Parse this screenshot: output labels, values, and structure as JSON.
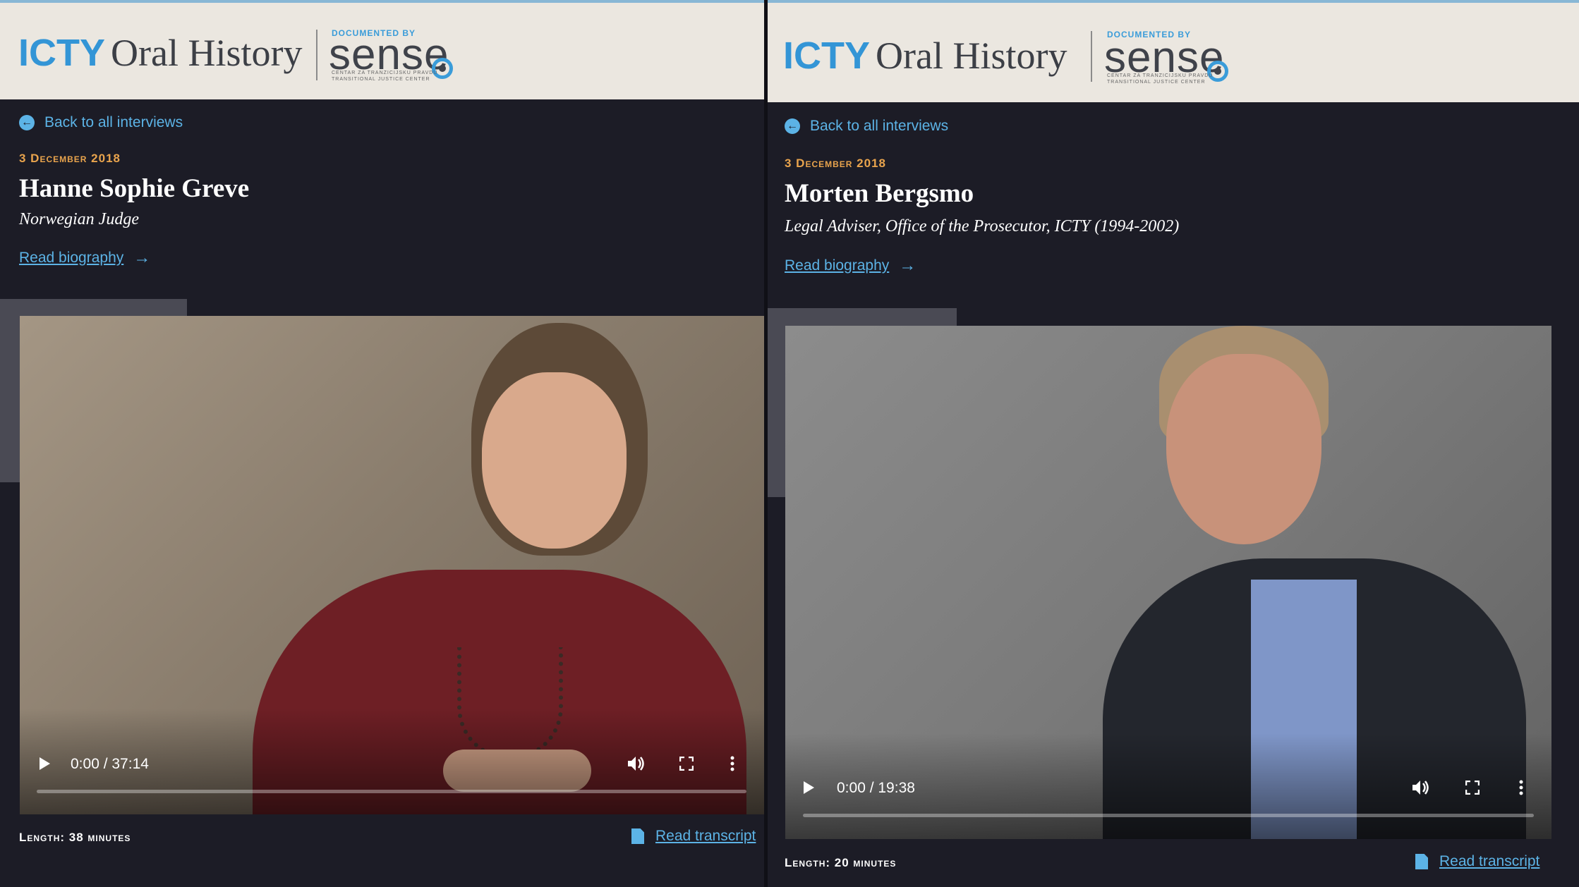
{
  "brand": {
    "icty": "ICTY",
    "oral_history": "Oral History",
    "documented_by": "DOCUMENTED BY",
    "sense": "sense",
    "sense_tagline_1": "CENTAR ZA TRANZICIJSKU PRAVDU",
    "sense_tagline_2": "TRANSITIONAL JUSTICE CENTER"
  },
  "icons": {
    "back": "arrow-left-circle-icon",
    "bio_arrow": "arrow-right-icon",
    "play": "play-icon",
    "volume": "volume-icon",
    "fullscreen": "fullscreen-icon",
    "more": "more-vertical-icon",
    "pdf": "pdf-file-icon"
  },
  "colors": {
    "accent_blue": "#5cb3e6",
    "date_orange": "#e9a44d",
    "page_background": "#1c1c26",
    "header_background": "#ebe7e0"
  },
  "panels": [
    {
      "back_label": "Back to all interviews",
      "date": "3 December 2018",
      "name": "Hanne Sophie Greve",
      "role": "Norwegian Judge",
      "read_bio": "Read biography",
      "video_time": "0:00 / 37:14",
      "video_progress": 0,
      "length": "Length: 38 minutes",
      "read_transcript": "Read transcript"
    },
    {
      "back_label": "Back to all interviews",
      "date": "3 December 2018",
      "name": "Morten Bergsmo",
      "role": "Legal Adviser, Office of the Prosecutor, ICTY (1994-2002)",
      "read_bio": "Read biography",
      "video_time": "0:00 / 19:38",
      "video_progress": 0,
      "length": "Length: 20 minutes",
      "read_transcript": "Read transcript"
    }
  ]
}
